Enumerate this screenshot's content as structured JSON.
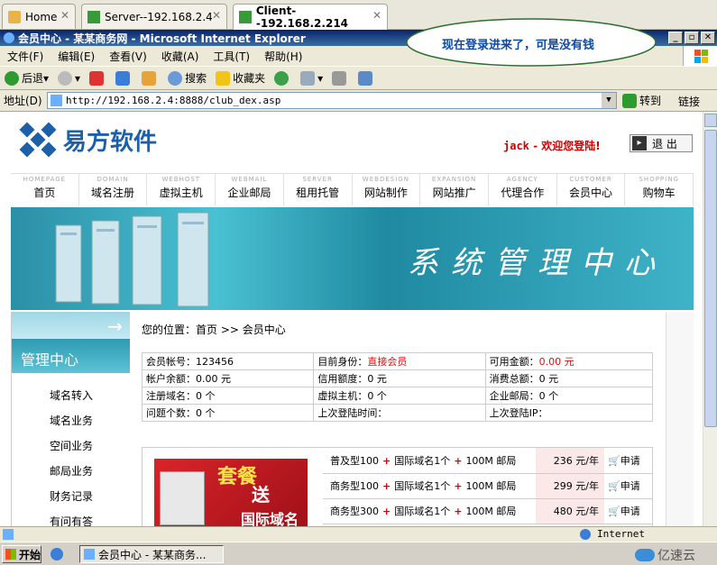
{
  "tabs": [
    {
      "label": "Home",
      "close": "✕"
    },
    {
      "label": "Server--192.168.2.4",
      "close": "✕"
    },
    {
      "label": "Client--192.168.2.214",
      "close": "✕"
    }
  ],
  "window": {
    "title": "会员中心 - 某某商务网 - Microsoft Internet Explorer",
    "buttons": [
      "_",
      "▫",
      "✕"
    ]
  },
  "callout": {
    "text": "现在登录进来了，可是没有钱"
  },
  "menu": [
    "文件(F)",
    "编辑(E)",
    "查看(V)",
    "收藏(A)",
    "工具(T)",
    "帮助(H)"
  ],
  "toolbar": {
    "back": "后退",
    "search": "搜索",
    "favorites": "收藏夹"
  },
  "address": {
    "label": "地址(D)",
    "url": "http://192.168.2.4:8888/club_dex.asp",
    "go": "转到",
    "links": "链接"
  },
  "site": {
    "name": "易方软件",
    "welcome_user": "jack",
    "welcome_text": " - 欢迎您登陆!",
    "logout": "退 出",
    "banner_text": "系统管理中心"
  },
  "nav": [
    {
      "en": "HOMEPAGE",
      "zh": "首页"
    },
    {
      "en": "DOMAIN",
      "zh": "域名注册"
    },
    {
      "en": "WEBHOST",
      "zh": "虚拟主机"
    },
    {
      "en": "WEBMAIL",
      "zh": "企业邮局"
    },
    {
      "en": "SERVER",
      "zh": "租用托管"
    },
    {
      "en": "WEBDESIGN",
      "zh": "网站制作"
    },
    {
      "en": "EXPANSION",
      "zh": "网站推广"
    },
    {
      "en": "AGENCY",
      "zh": "代理合作"
    },
    {
      "en": "CUSTOMER",
      "zh": "会员中心"
    },
    {
      "en": "SHOPPING",
      "zh": "购物车"
    }
  ],
  "sidebar": {
    "title": "管理中心",
    "items": [
      "域名转入",
      "域名业务",
      "空间业务",
      "邮局业务",
      "财务记录",
      "有问有答"
    ]
  },
  "breadcrumb": "您的位置：首页 >> 会员中心",
  "account": {
    "rows": [
      [
        {
          "label": "会员帐号：",
          "value": "123456"
        },
        {
          "label": "目前身份：",
          "value": "直接会员",
          "red": true
        },
        {
          "label": "可用金额：",
          "value": "0.00 元",
          "red": true
        }
      ],
      [
        {
          "label": "帐户余额：",
          "value": "0.00 元"
        },
        {
          "label": "信用额度：",
          "value": "0 元"
        },
        {
          "label": "消费总额：",
          "value": "0 元"
        }
      ],
      [
        {
          "label": "注册域名：",
          "value": "0 个"
        },
        {
          "label": "虚拟主机：",
          "value": "0 个"
        },
        {
          "label": "企业邮局：",
          "value": "0 个"
        }
      ],
      [
        {
          "label": "问题个数：",
          "value": "0 个"
        },
        {
          "label": "上次登陆时间：",
          "value": ""
        },
        {
          "label": "上次登陆IP：",
          "value": ""
        }
      ]
    ]
  },
  "packages": {
    "image_text_1": "套餐",
    "image_text_2": "送",
    "image_text_3": "国际域名",
    "rows": [
      {
        "name": "普及型100",
        "domain": "国际域名1个",
        "mail": "100M 邮局",
        "price": "236 元/年",
        "apply": "申请"
      },
      {
        "name": "商务型100",
        "domain": "国际域名1个",
        "mail": "100M 邮局",
        "price": "299 元/年",
        "apply": "申请"
      },
      {
        "name": "商务型300",
        "domain": "国际域名1个",
        "mail": "100M 邮局",
        "price": "480 元/年",
        "apply": "申请"
      }
    ]
  },
  "status": {
    "zone": "Internet"
  },
  "taskbar": {
    "start": "开始",
    "window": "会员中心 - 某某商务...",
    "watermark": "亿速云"
  },
  "colors": {
    "red": "#e01010",
    "titlebar": "#0a246a",
    "banner": "#2a8fa7"
  }
}
